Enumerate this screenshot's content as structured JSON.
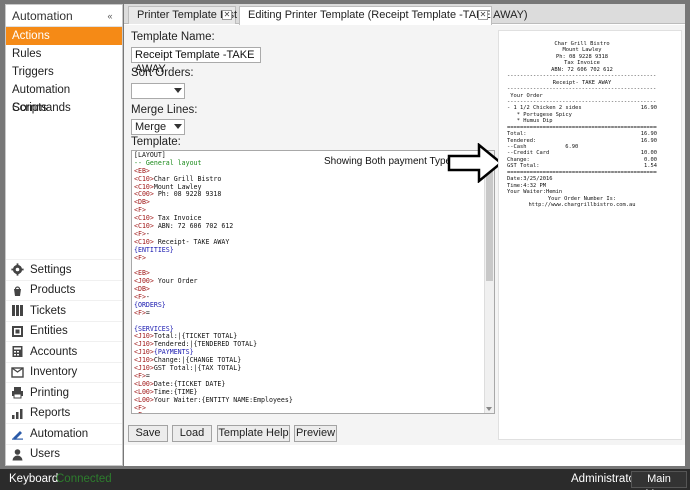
{
  "sidebar": {
    "section_title": "Automation",
    "collapse_glyph": "«",
    "submenu": [
      "Actions",
      "Rules",
      "Triggers",
      "Automation Commands",
      "Scripts"
    ],
    "nav": [
      {
        "label": "Settings",
        "icon": "gear-icon"
      },
      {
        "label": "Products",
        "icon": "products-icon"
      },
      {
        "label": "Tickets",
        "icon": "tickets-icon"
      },
      {
        "label": "Entities",
        "icon": "entities-icon"
      },
      {
        "label": "Accounts",
        "icon": "accounts-icon"
      },
      {
        "label": "Inventory",
        "icon": "inventory-icon"
      },
      {
        "label": "Printing",
        "icon": "printer-icon"
      },
      {
        "label": "Reports",
        "icon": "reports-icon"
      },
      {
        "label": "Automation",
        "icon": "automation-icon"
      },
      {
        "label": "Users",
        "icon": "user-icon"
      }
    ]
  },
  "tabs": [
    {
      "label": "Printer Template List",
      "active": false
    },
    {
      "label": "Editing Printer Template (Receipt Template -TAKE AWAY)",
      "active": true
    }
  ],
  "form": {
    "template_name_label": "Template Name:",
    "template_name_value": "Receipt Template -TAKE AWAY",
    "sort_orders_label": "Sort Orders:",
    "sort_orders_value": "",
    "merge_lines_label": "Merge Lines:",
    "merge_lines_value": "Merge",
    "template_label": "Template:"
  },
  "annotation": "Showing Both payment Types",
  "template_code": [
    {
      "text": "[LAYOUT]",
      "kind": "default"
    },
    {
      "text": "-- General layout",
      "kind": "comment"
    },
    {
      "text": "<EB>",
      "kind": "tag"
    },
    {
      "text": "<C10>Char Grill Bistro",
      "kind": "mixed",
      "tag": "<C10>",
      "rest": "Char Grill Bistro"
    },
    {
      "text": "<C10>Mount Lawley",
      "kind": "mixed",
      "tag": "<C10>",
      "rest": "Mount Lawley"
    },
    {
      "text": "<C00> Ph: 08 9228 9318",
      "kind": "mixed",
      "tag": "<C00>",
      "rest": " Ph: 08 9228 9318"
    },
    {
      "text": "<DB>",
      "kind": "tag"
    },
    {
      "text": "<F>",
      "kind": "tag"
    },
    {
      "text": "<C10> Tax Invoice",
      "kind": "mixed",
      "tag": "<C10>",
      "rest": " Tax Invoice"
    },
    {
      "text": "<C10> ABN: 72 606 702 612",
      "kind": "mixed",
      "tag": "<C10>",
      "rest": " ABN: 72 606 702 612"
    },
    {
      "text": "<F>-",
      "kind": "mixed",
      "tag": "<F>",
      "rest": "-"
    },
    {
      "text": "<C10> Receipt- TAKE AWAY",
      "kind": "mixed",
      "tag": "<C10>",
      "rest": " Receipt- TAKE AWAY"
    },
    {
      "text": "{ENTITIES}",
      "kind": "section"
    },
    {
      "text": "<F>",
      "kind": "tag"
    },
    {
      "text": "",
      "kind": "default"
    },
    {
      "text": "<EB>",
      "kind": "tag"
    },
    {
      "text": "<J00> Your Order",
      "kind": "mixed",
      "tag": "<J00>",
      "rest": " Your Order"
    },
    {
      "text": "<DB>",
      "kind": "tag"
    },
    {
      "text": "<F>-",
      "kind": "mixed",
      "tag": "<F>",
      "rest": "-"
    },
    {
      "text": "{ORDERS}",
      "kind": "section"
    },
    {
      "text": "<F>=",
      "kind": "mixed",
      "tag": "<F>",
      "rest": "="
    },
    {
      "text": "",
      "kind": "default"
    },
    {
      "text": "{SERVICES}",
      "kind": "section"
    },
    {
      "text": "<J10>Total:|{TICKET TOTAL}",
      "kind": "mixed",
      "tag": "<J10>",
      "rest": "Total:|{TICKET TOTAL}"
    },
    {
      "text": "<J10>Tendered:|{TENDERED TOTAL}",
      "kind": "mixed",
      "tag": "<J10>",
      "rest": "Tendered:|{TENDERED TOTAL}"
    },
    {
      "text": "<J10>{PAYMENTS}",
      "kind": "mixed",
      "tag": "<J10>",
      "rest": "{PAYMENTS}",
      "rest_kind": "section"
    },
    {
      "text": "<J10>Change:|{CHANGE TOTAL}",
      "kind": "mixed",
      "tag": "<J10>",
      "rest": "Change:|{CHANGE TOTAL}"
    },
    {
      "text": "<J10>GST Total:|{TAX TOTAL}",
      "kind": "mixed",
      "tag": "<J10>",
      "rest": "GST Total:|{TAX TOTAL}"
    },
    {
      "text": "<F>=",
      "kind": "mixed",
      "tag": "<F>",
      "rest": "="
    },
    {
      "text": "<L00>Date:{TICKET DATE}",
      "kind": "mixed",
      "tag": "<L00>",
      "rest": "Date:{TICKET DATE}"
    },
    {
      "text": "<L00>Time:{TIME}",
      "kind": "mixed",
      "tag": "<L00>",
      "rest": "Time:{TIME}"
    },
    {
      "text": "<L00>Your Waiter:{ENTITY NAME:Employees}",
      "kind": "mixed",
      "tag": "<L00>",
      "rest": "Your Waiter:{ENTITY NAME:Employees}"
    },
    {
      "text": "<F>",
      "kind": "tag"
    },
    {
      "text": "<F>",
      "kind": "tag"
    }
  ],
  "receipt": [
    {
      "text": "Char Grill Bistro",
      "align": "center"
    },
    {
      "text": "Mount Lawley",
      "align": "center"
    },
    {
      "text": "Ph: 08 9228 9318",
      "align": "center"
    },
    {
      "text": "Tax Invoice",
      "align": "center"
    },
    {
      "text": "ABN: 72 606 702 612",
      "align": "center"
    },
    {
      "text": "------------------------------------------------",
      "align": "left"
    },
    {
      "text": "Receipt- TAKE AWAY",
      "align": "center"
    },
    {
      "text": "------------------------------------------------",
      "align": "left"
    },
    {
      "text": " Your Order",
      "align": "left"
    },
    {
      "text": "------------------------------------------------",
      "align": "left"
    },
    {
      "left": "- 1 1/2 Chicken 2 sides",
      "right": "16.90"
    },
    {
      "text": "   * Portugese Spicy",
      "align": "left"
    },
    {
      "text": "   * Humus Dip",
      "align": "left"
    },
    {
      "text": "================================================",
      "align": "left"
    },
    {
      "left": "Total:",
      "right": "16.90"
    },
    {
      "left": "Tendered:",
      "right": "16.90"
    },
    {
      "left": "--Cash",
      "mid": "6.90",
      "right": ""
    },
    {
      "left": "--Credit Card",
      "right": "10.00"
    },
    {
      "left": "Change:",
      "right": "0.00"
    },
    {
      "left": "GST Total:",
      "right": "1.54"
    },
    {
      "text": "================================================",
      "align": "left"
    },
    {
      "text": "Date:3/25/2016",
      "align": "left"
    },
    {
      "text": "Time:4:32 PM",
      "align": "left"
    },
    {
      "text": "Your Waiter:Hemin",
      "align": "left"
    },
    {
      "text": "Your Order Number Is:",
      "align": "center"
    },
    {
      "text": "http://www.chargrillbistro.com.au",
      "align": "center"
    }
  ],
  "buttons": {
    "save": "Save",
    "load": "Load",
    "template_help": "Template Help",
    "preview": "Preview"
  },
  "statusbar": {
    "keyboard": "Keyboard",
    "connected": "Connected",
    "user": "Administrator",
    "main_menu": "Main Menu"
  },
  "colors": {
    "accent": "#f58a16",
    "tag": "#a01818",
    "comment": "#1a8a1a",
    "section": "#1a1ab0",
    "connected": "#2d7d2d"
  }
}
